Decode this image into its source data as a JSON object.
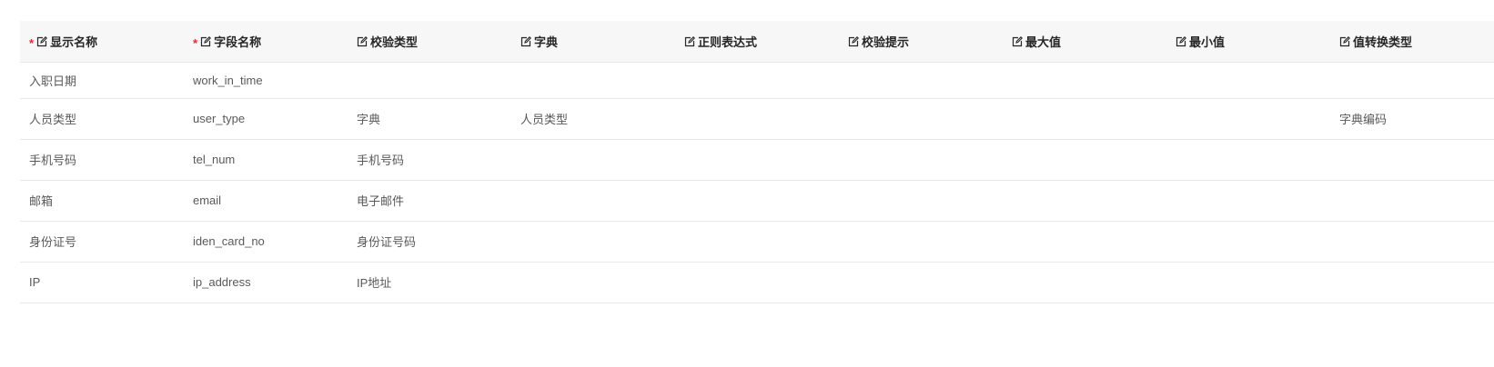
{
  "table": {
    "columns": [
      {
        "label": "显示名称",
        "required": true
      },
      {
        "label": "字段名称",
        "required": true
      },
      {
        "label": "校验类型",
        "required": false
      },
      {
        "label": "字典",
        "required": false
      },
      {
        "label": "正则表达式",
        "required": false
      },
      {
        "label": "校验提示",
        "required": false
      },
      {
        "label": "最大值",
        "required": false
      },
      {
        "label": "最小值",
        "required": false
      },
      {
        "label": "值转换类型",
        "required": false
      }
    ],
    "required_mark": "*",
    "rows": [
      [
        "入职日期",
        "work_in_time",
        "",
        "",
        "",
        "",
        "",
        "",
        ""
      ],
      [
        "人员类型",
        "user_type",
        "字典",
        "人员类型",
        "",
        "",
        "",
        "",
        "字典编码"
      ],
      [
        "手机号码",
        "tel_num",
        "手机号码",
        "",
        "",
        "",
        "",
        "",
        ""
      ],
      [
        "邮箱",
        "email",
        "电子邮件",
        "",
        "",
        "",
        "",
        "",
        ""
      ],
      [
        "身份证号",
        "iden_card_no",
        "身份证号码",
        "",
        "",
        "",
        "",
        "",
        ""
      ],
      [
        "IP",
        "ip_address",
        "IP地址",
        "",
        "",
        "",
        "",
        "",
        ""
      ]
    ]
  },
  "icons": {
    "header_icon": "edit-icon"
  },
  "colors": {
    "required": "#f5222d",
    "header_bg": "#f7f7f7",
    "border": "#e8e8e8"
  }
}
